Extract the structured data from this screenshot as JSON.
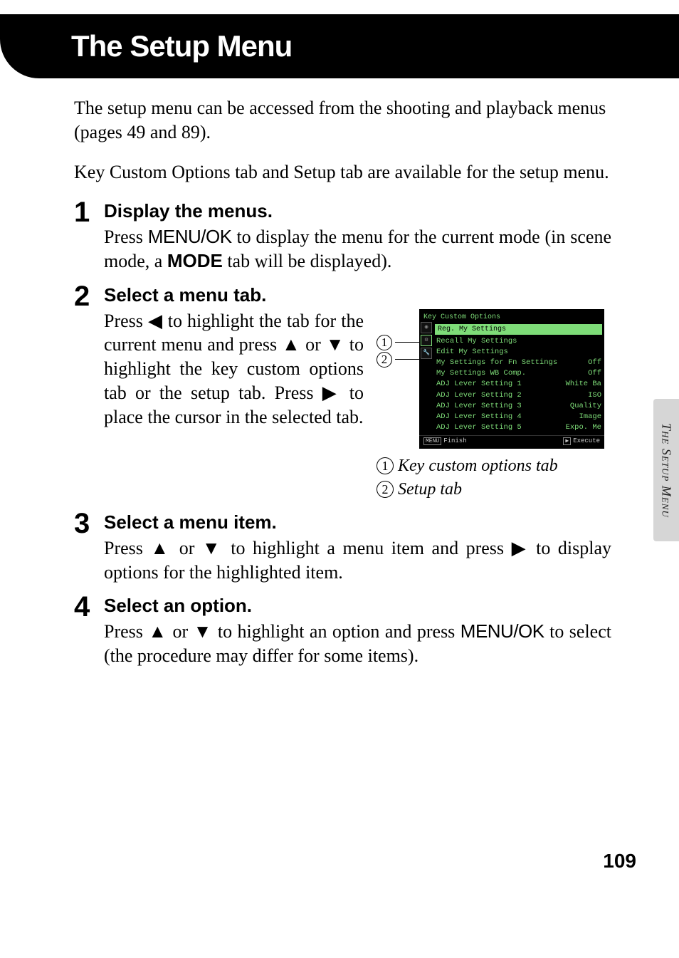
{
  "header": {
    "title": "The Setup Menu"
  },
  "intro1": "The setup menu can be accessed from the shooting and playback menus (pages 49 and 89).",
  "intro2": "Key Custom Options tab and Setup tab are available for the setup menu.",
  "steps": {
    "s1": {
      "num": "1",
      "heading": "Display the menus.",
      "text_a": "Press ",
      "menu_ok": "MENU/OK",
      "text_b": " to display the menu for the current mode (in scene mode, a ",
      "mode": "MODE",
      "text_c": " tab will be displayed)."
    },
    "s2": {
      "num": "2",
      "heading": "Select a menu tab.",
      "text": "Press ◀ to highlight the tab for the current menu and press ▲ or ▼ to highlight the key custom options tab or the setup tab. Press ▶ to place the cursor in the selected tab."
    },
    "s3": {
      "num": "3",
      "heading": "Select a menu item.",
      "text": "Press ▲ or ▼ to highlight a menu item and press ▶ to display options for the highlighted item."
    },
    "s4": {
      "num": "4",
      "heading": "Select an option.",
      "text_a": "Press ▲ or ▼ to highlight an option and press ",
      "menu_ok": "MENU/OK",
      "text_b": " to select (the procedure may differ for some items)."
    }
  },
  "lcd": {
    "title": "Key Custom Options",
    "highlight": "Reg. My Settings",
    "rows": [
      {
        "l": "Recall My Settings",
        "r": ""
      },
      {
        "l": "Edit My Settings",
        "r": ""
      },
      {
        "l": "My Settings for Fn Settings",
        "r": "Off"
      },
      {
        "l": "My Settings WB Comp.",
        "r": "Off"
      },
      {
        "l": "ADJ Lever Setting 1",
        "r": "White Ba"
      },
      {
        "l": "ADJ Lever Setting 2",
        "r": "ISO"
      },
      {
        "l": "ADJ Lever Setting 3",
        "r": "Quality"
      },
      {
        "l": "ADJ Lever Setting 4",
        "r": "Image"
      },
      {
        "l": "ADJ Lever Setting 5",
        "r": "Expo. Me"
      }
    ],
    "foot_left_key": "MENU",
    "foot_left": "Finish",
    "foot_right_key": "▶",
    "foot_right": "Execute"
  },
  "legend": {
    "c1": "1",
    "t1": "Key custom options tab",
    "c2": "2",
    "t2": "Setup tab"
  },
  "side_tab": "The Setup Menu",
  "page_num": "109",
  "callouts": {
    "c1": "1",
    "c2": "2"
  }
}
